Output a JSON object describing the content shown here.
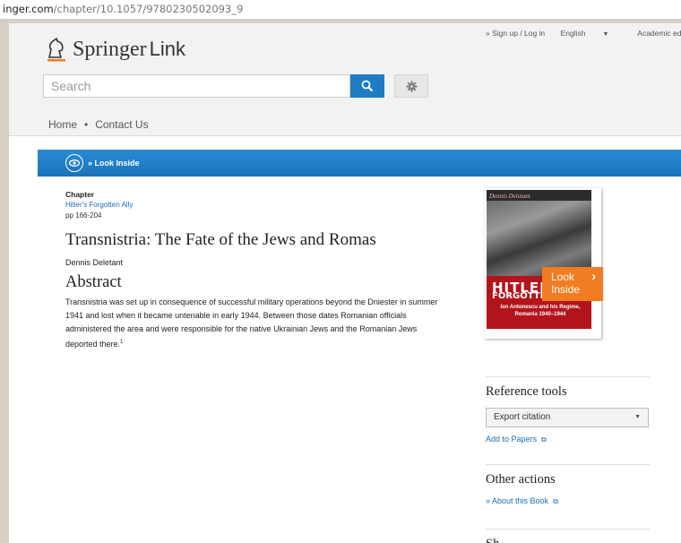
{
  "url": {
    "host": "inger.com",
    "path": "/chapter/10.1057/9780230502093_9"
  },
  "header": {
    "brand": "Springer",
    "brand_suffix": "Link",
    "top_links": {
      "signup": "» Sign up / Log in",
      "language": "English",
      "edition": "Academic edition"
    },
    "search_placeholder": "Search"
  },
  "nav": {
    "home": "Home",
    "separator": "•",
    "contact": "Contact Us"
  },
  "look_inside_bar": {
    "label": "» Look Inside"
  },
  "chapter": {
    "type_label": "Chapter",
    "book_title": "Hitler's Forgotten Ally",
    "pages": "pp 166-204",
    "title": "Transnistria: The Fate of the Jews and Romas",
    "author": "Dennis Deletant",
    "abstract_heading": "Abstract",
    "abstract_text": "Transnistria was set up in consequence of successful military operations beyond the Dniester in summer 1941 and lost when it became untenable in early 1944. Between those dates Romanian officials administered the area and were responsible for the native Ukrainian Jews and the Romanian Jews deported there.",
    "footnote_marker": "1"
  },
  "cover": {
    "author": "Dennis Deletant",
    "title_line1": "HITLER",
    "title_line2": "FORGOTTEN",
    "subtitle": "Ion Antonescu and his Regime, Romania 1940–1944",
    "look_label_1": "Look",
    "look_label_2": "Inside"
  },
  "sidebar": {
    "reference_heading": "Reference tools",
    "export_value": "Export citation",
    "add_papers": "Add to Papers",
    "other_heading": "Other actions",
    "about_book": "» About this Book",
    "share_heading": "Sh"
  },
  "colors": {
    "accent_blue": "#1f7cc2",
    "look_orange": "#f17c21",
    "link_blue": "#1a6fb5"
  }
}
